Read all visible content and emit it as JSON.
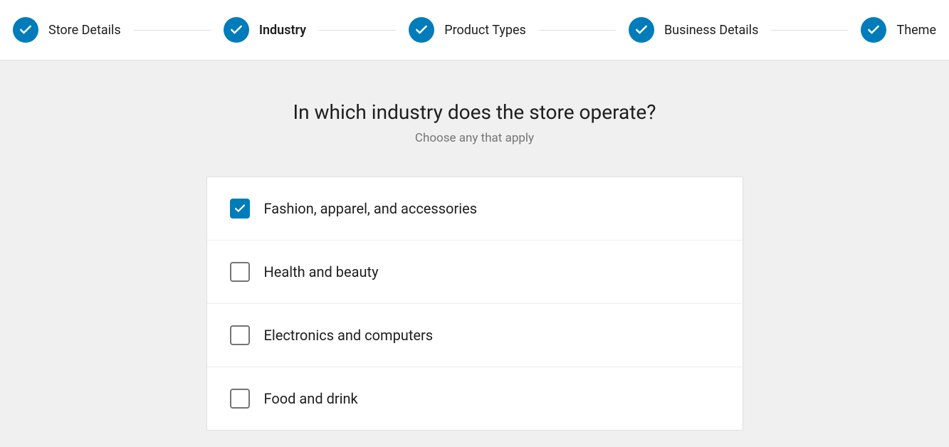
{
  "stepper": {
    "steps": [
      {
        "label": "Store Details"
      },
      {
        "label": "Industry"
      },
      {
        "label": "Product Types"
      },
      {
        "label": "Business Details"
      },
      {
        "label": "Theme"
      }
    ],
    "activeIndex": 1
  },
  "page": {
    "heading": "In which industry does the store operate?",
    "subheading": "Choose any that apply"
  },
  "options": [
    {
      "label": "Fashion, apparel, and accessories",
      "checked": true
    },
    {
      "label": "Health and beauty",
      "checked": false
    },
    {
      "label": "Electronics and computers",
      "checked": false
    },
    {
      "label": "Food and drink",
      "checked": false
    }
  ]
}
